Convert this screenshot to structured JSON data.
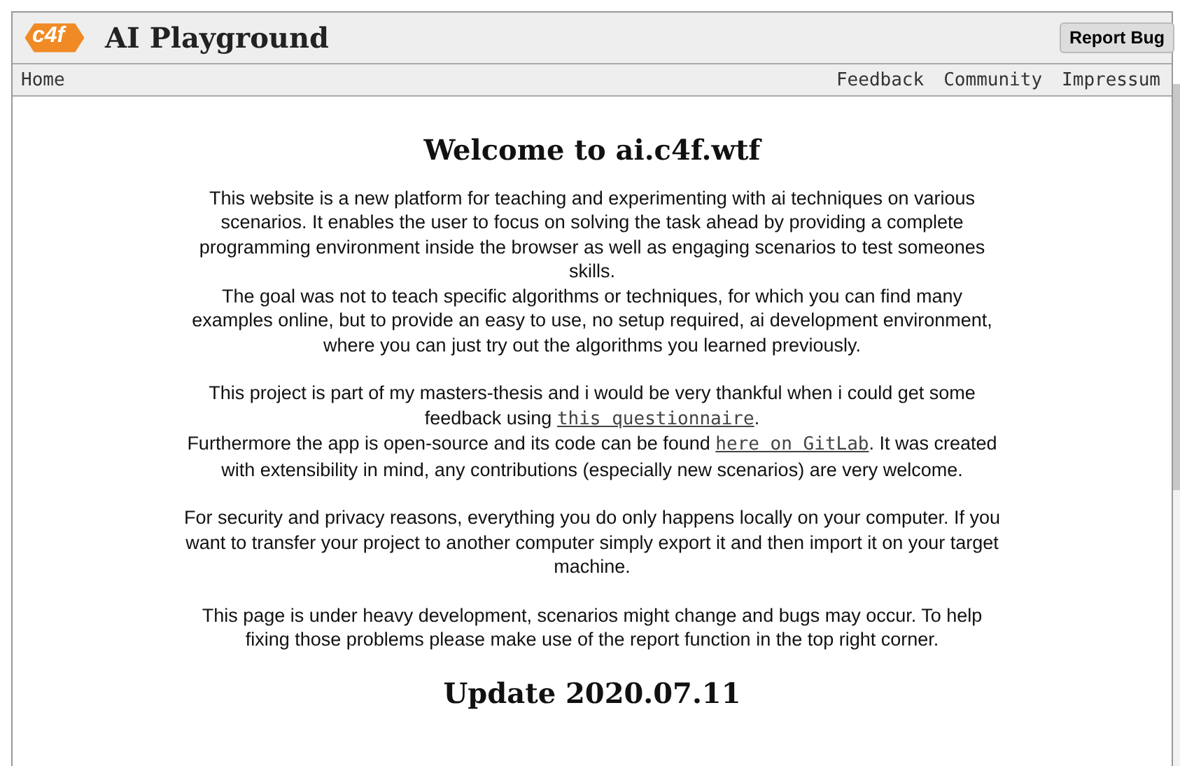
{
  "header": {
    "logo": "c4f",
    "title": "AI Playground",
    "report_button": "Report Bug"
  },
  "nav": {
    "left": [
      {
        "label": "Home"
      }
    ],
    "right": [
      {
        "label": "Feedback"
      },
      {
        "label": "Community"
      },
      {
        "label": "Impressum"
      }
    ]
  },
  "content": {
    "heading": "Welcome to ai.c4f.wtf",
    "paragraphs": [
      [
        [
          {
            "text": "This website is a new platform for teaching and experimenting with ai techniques on various scenarios. It enables the user to focus on solving the task ahead by providing a complete programming environment inside the browser as well as engaging scenarios to test someones skills."
          }
        ],
        [
          {
            "text": "The goal was not to teach specific algorithms or techniques, for which you can find many examples online, but to provide an easy to use, no setup required, ai development environment, where you can just try out the algorithms you learned previously."
          }
        ]
      ],
      [
        [
          {
            "text": "This project is part of my masters-thesis and i would be very thankful when i could get some feedback using "
          },
          {
            "text": "this questionnaire",
            "link": true
          },
          {
            "text": "."
          }
        ],
        [
          {
            "text": "Furthermore the app is open-source and its code can be found "
          },
          {
            "text": "here on GitLab",
            "link": true
          },
          {
            "text": ". It was created with extensibility in mind, any contributions (especially new scenarios) are very welcome."
          }
        ]
      ],
      [
        [
          {
            "text": "For security and privacy reasons, everything you do only happens locally on your computer. If you want to transfer your project to another computer simply export it and then import it on your target machine."
          }
        ]
      ],
      [
        [
          {
            "text": "This page is under heavy development, scenarios might change and bugs may occur. To help fixing those problems please make use of the report function in the top right corner."
          }
        ]
      ]
    ],
    "update_heading": "Update 2020.07.11"
  }
}
